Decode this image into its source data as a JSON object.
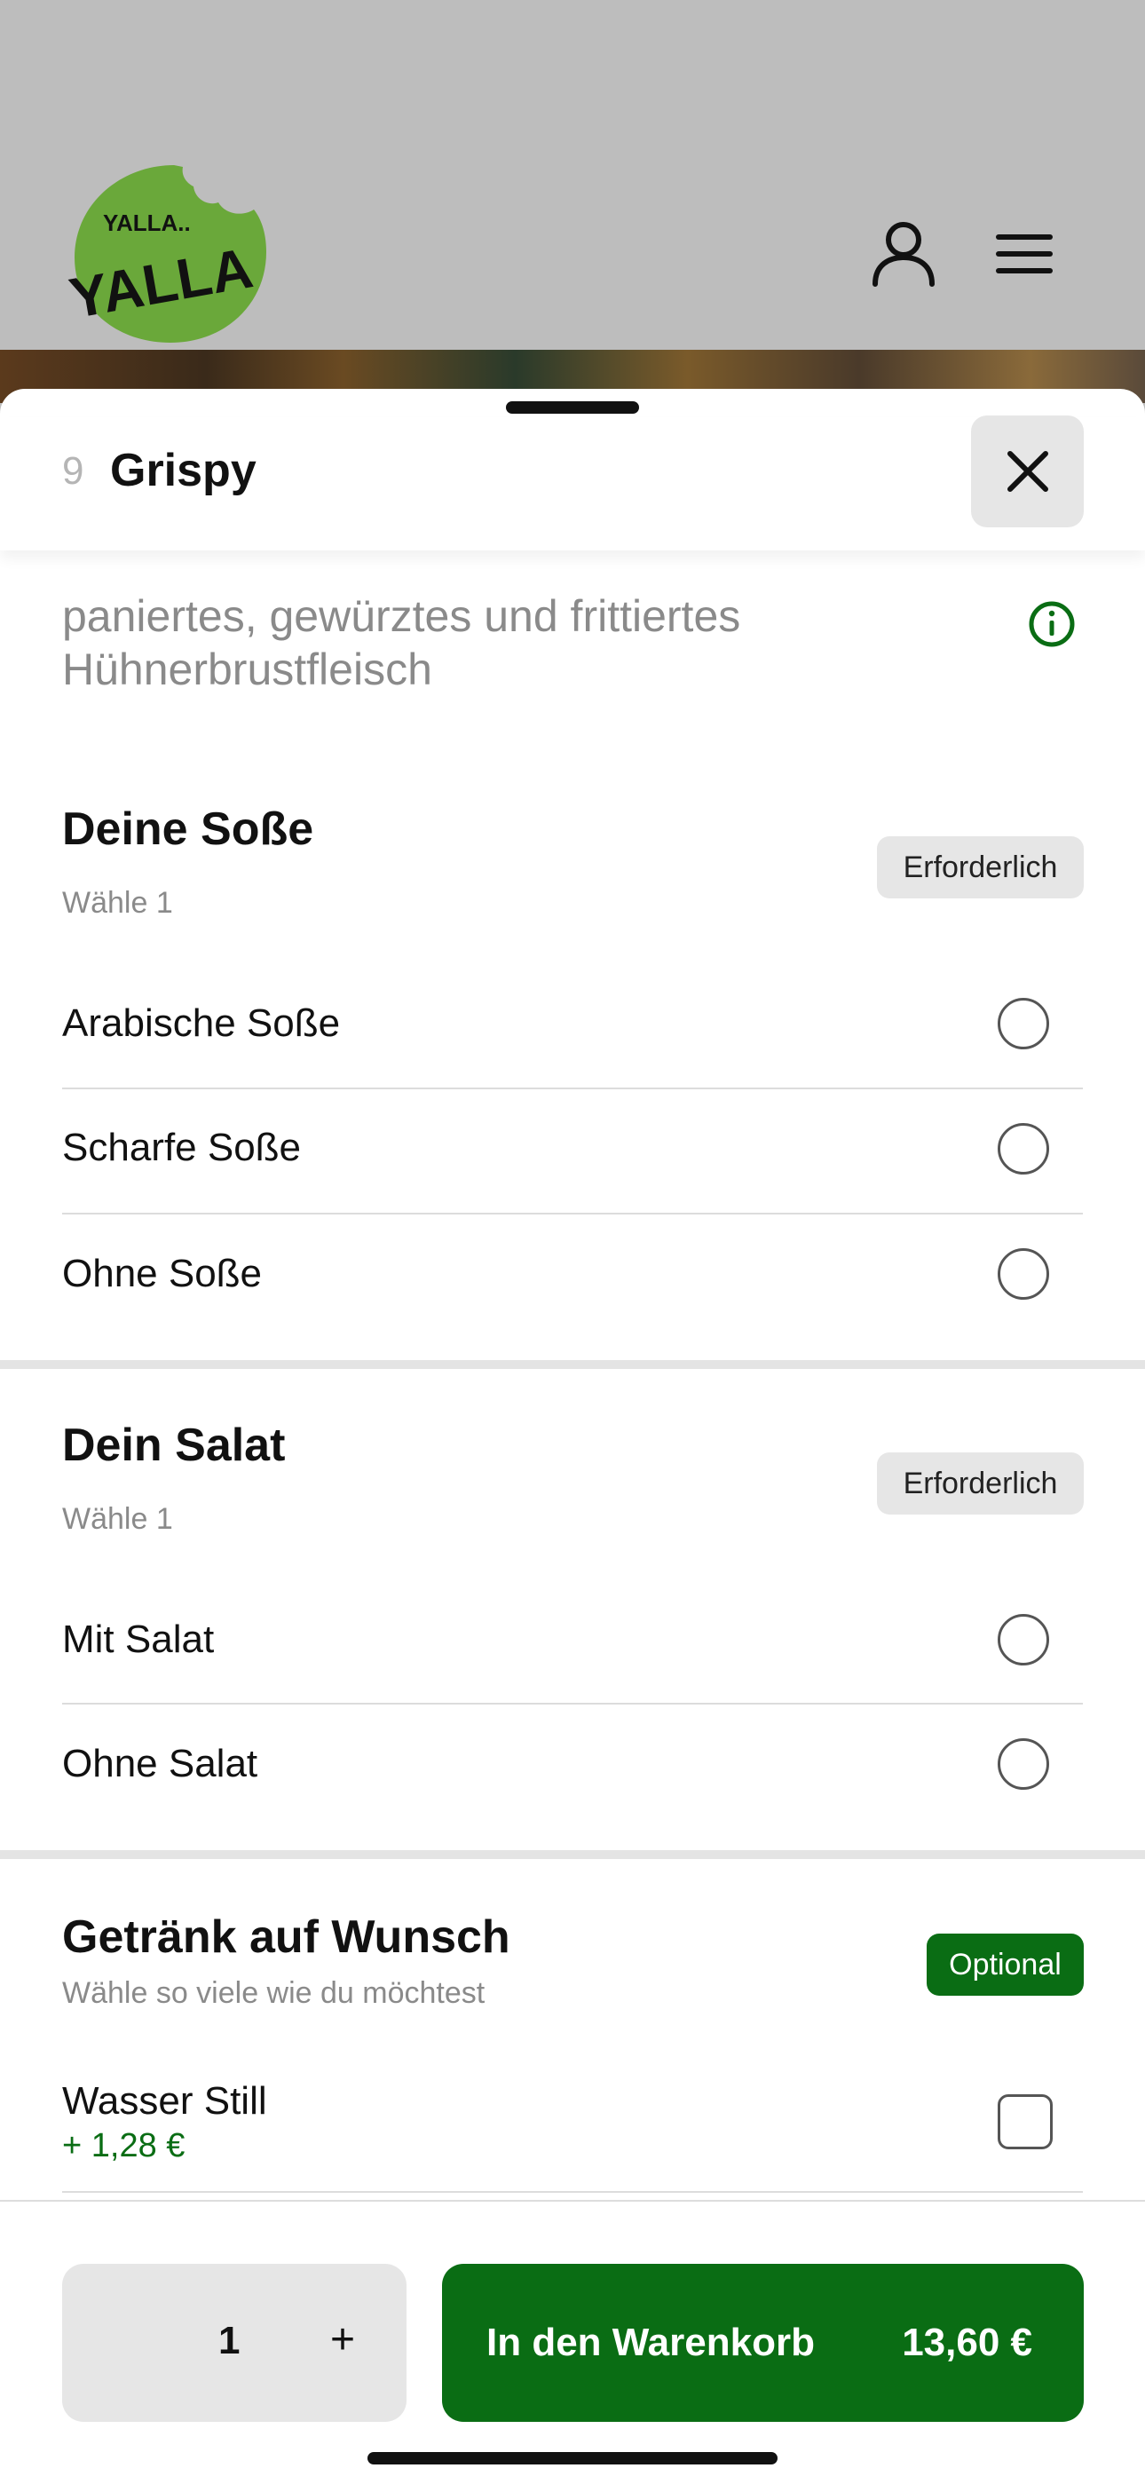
{
  "header": {
    "logo_text_top": "YALLA..",
    "logo_text_main": "YALLA",
    "account_icon": "person-icon",
    "menu_icon": "hamburger-menu-icon"
  },
  "item": {
    "number": "9",
    "name": "Grispy",
    "description": "paniertes, gewürztes und frittiertes Hühnerbrustfleisch",
    "close_icon": "close-icon",
    "info_icon": "info-icon"
  },
  "sections": [
    {
      "title": "Deine Soße",
      "subtitle": "Wähle 1",
      "badge": "Erforderlich",
      "options": [
        {
          "label": "Arabische Soße"
        },
        {
          "label": "Scharfe Soße"
        },
        {
          "label": "Ohne Soße"
        }
      ]
    },
    {
      "title": "Dein Salat",
      "subtitle": "Wähle 1",
      "badge": "Erforderlich",
      "options": [
        {
          "label": "Mit Salat"
        },
        {
          "label": "Ohne Salat"
        }
      ]
    },
    {
      "title": "Getränk auf Wunsch",
      "subtitle": "Wähle so viele wie du möchtest",
      "badge": "Optional",
      "options": [
        {
          "label": "Wasser Still",
          "price": "+ 1,28 €"
        }
      ]
    }
  ],
  "footer": {
    "quantity": "1",
    "plus_label": "+",
    "cart_label": "In den Warenkorb",
    "cart_price": "13,60 €"
  },
  "colors": {
    "brand_green": "#0a6d14",
    "logo_green": "#6aa83a",
    "header_bg": "#bdbdbd"
  }
}
